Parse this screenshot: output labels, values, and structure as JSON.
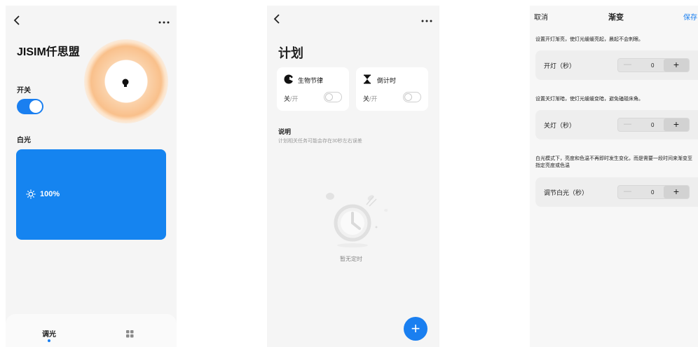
{
  "screen1": {
    "device_name": "JISIM仟思盟",
    "switch_label": "开关",
    "switch_on": true,
    "white_label": "白光",
    "brightness": "100%",
    "tabs": [
      {
        "label": "调光"
      }
    ],
    "accent_color": "#1a7ff0",
    "icons": [
      "back-icon",
      "more-icon",
      "bulb-icon",
      "sun-icon",
      "grid-icon"
    ]
  },
  "screen2": {
    "title": "计划",
    "cards": [
      {
        "name": "生物节律",
        "state_off": "关",
        "state_sep": "/",
        "state_on": "开",
        "icon": "circadian-icon"
      },
      {
        "name": "倒计时",
        "state_off": "关",
        "state_sep": "/",
        "state_on": "开",
        "icon": "hourglass-icon"
      }
    ],
    "desc_title": "说明",
    "desc_text": "计划相关任务可能会存在30秒左右误差",
    "empty_text": "暂无定时",
    "fab_label": "+"
  },
  "screen3": {
    "cancel": "取消",
    "title": "渐变",
    "save": "保存",
    "sections": [
      {
        "desc": "设置开灯渐亮，使灯光缓缓亮起，晨起不会刺眼。",
        "label": "开灯（秒）",
        "value": "0"
      },
      {
        "desc": "设置关灯渐暗，使灯光缓缓变暗，避免磕碰床角。",
        "label": "关灯（秒）",
        "value": "0"
      },
      {
        "desc": "白光模式下，亮度和色温不再即时发生变化，而是需要一段时间来渐变至指定亮度或色温",
        "label": "调节白光（秒）",
        "value": "0"
      }
    ],
    "minus": "—",
    "plus": "+"
  }
}
